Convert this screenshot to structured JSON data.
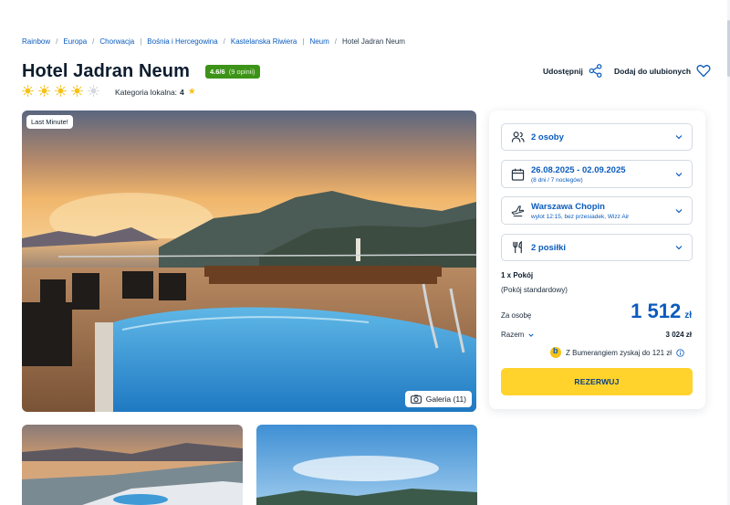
{
  "breadcrumb": [
    {
      "label": "Rainbow",
      "current": false
    },
    {
      "label": "Europa",
      "current": false
    },
    {
      "label": "Chorwacja",
      "current": false
    },
    {
      "label": "Bośnia i Hercegowina",
      "current": false
    },
    {
      "label": "Kastelanska Riwiera",
      "current": false
    },
    {
      "label": "Neum",
      "current": false
    },
    {
      "label": "Hotel Jadran Neum",
      "current": true
    }
  ],
  "hotel": {
    "name": "Hotel Jadran Neum",
    "rating_score": "4.6/6",
    "rating_count": "(9 opinii)",
    "sun_rating": 4,
    "sun_max": 5,
    "local_category_label": "Kategoria lokalna:",
    "local_category_value": "4"
  },
  "actions": {
    "share_label": "Udostępnij",
    "favorite_label": "Dodaj do ulubionych"
  },
  "gallery": {
    "badge": "Last Minute!",
    "button_label": "Galeria (11)"
  },
  "booking": {
    "persons": "2 osoby",
    "dates": "26.08.2025 - 02.09.2025",
    "dates_sub": "(8 dni / 7 noclegów)",
    "departure": "Warszawa Chopin",
    "departure_sub": "wylot 12:15, bez przesiadek, Wizz Air",
    "meals": "2 posiłki",
    "room_count": "1 x Pokój",
    "room_type": "(Pokój standardowy)",
    "per_person_label": "Za osobę",
    "price_per_person": "1 512",
    "currency": "zł",
    "total_label": "Razem",
    "total_value": "3 024 zł",
    "bumerang_text": "Z Bumerangiem zyskaj do 121 zł",
    "reserve_label": "REZERWUJ"
  },
  "colors": {
    "accent_blue": "#0a5bbd",
    "rating_green": "#3d9317",
    "cta_yellow": "#ffd32c",
    "sun_yellow": "#f6c21a"
  },
  "icons": {
    "share": "share-icon",
    "favorite": "heart-icon",
    "persons": "users-icon",
    "dates": "calendar-icon",
    "departure": "plane-icon",
    "meals": "cutlery-icon",
    "gallery": "camera-icon",
    "chevron": "chevron-down-icon",
    "info": "info-icon"
  }
}
